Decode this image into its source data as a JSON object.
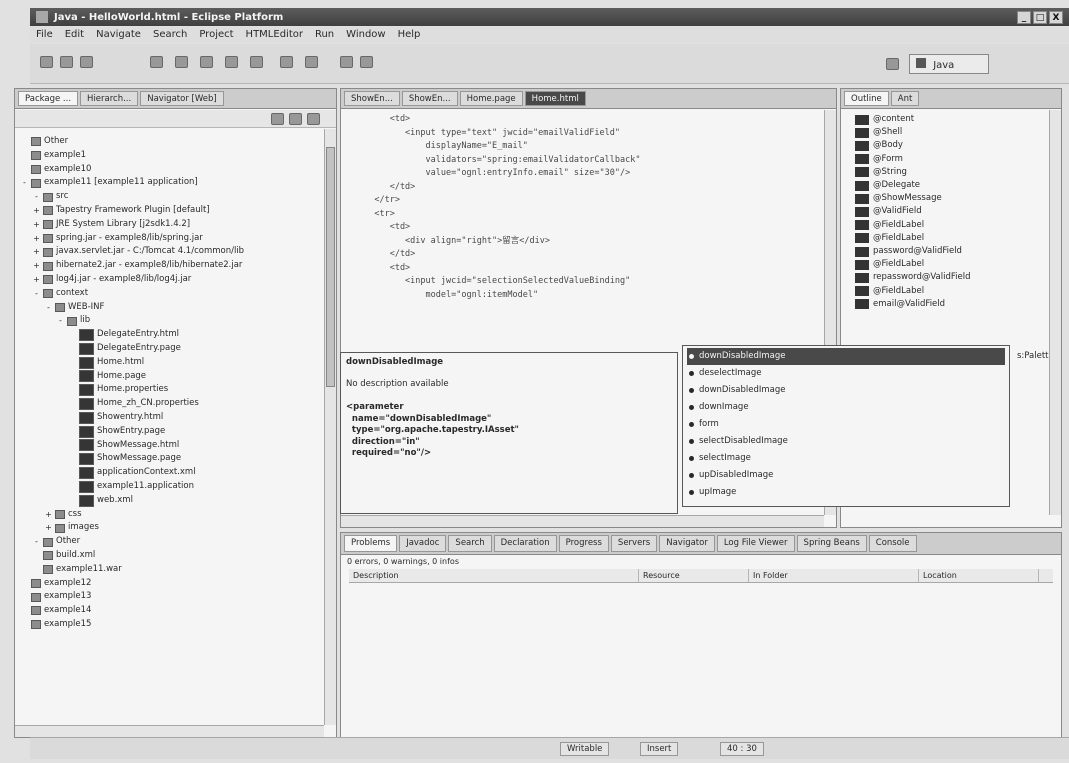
{
  "window": {
    "title": "Java - HelloWorld.html - Eclipse Platform",
    "controls": [
      "_",
      "□",
      "X"
    ]
  },
  "menu": [
    "File",
    "Edit",
    "Navigate",
    "Search",
    "Project",
    "HTMLEditor",
    "Run",
    "Window",
    "Help"
  ],
  "perspective": "Java",
  "left_panel": {
    "tabs": [
      "Package ...",
      "Hierarch...",
      "Navigator [Web]"
    ],
    "tree": [
      {
        "indent": 0,
        "exp": "",
        "label": "Other"
      },
      {
        "indent": 0,
        "exp": "",
        "label": "example1"
      },
      {
        "indent": 0,
        "exp": "",
        "label": "example10"
      },
      {
        "indent": 0,
        "exp": "-",
        "label": "example11 [example11 application]"
      },
      {
        "indent": 1,
        "exp": "-",
        "label": "src"
      },
      {
        "indent": 1,
        "exp": "+",
        "label": "Tapestry Framework Plugin [default]"
      },
      {
        "indent": 1,
        "exp": "+",
        "label": "JRE System Library [j2sdk1.4.2]"
      },
      {
        "indent": 1,
        "exp": "+",
        "label": "spring.jar - example8/lib/spring.jar"
      },
      {
        "indent": 1,
        "exp": "+",
        "label": "javax.servlet.jar - C:/Tomcat 4.1/common/lib"
      },
      {
        "indent": 1,
        "exp": "+",
        "label": "hibernate2.jar - example8/lib/hibernate2.jar"
      },
      {
        "indent": 1,
        "exp": "+",
        "label": "log4j.jar - example8/lib/log4j.jar"
      },
      {
        "indent": 1,
        "exp": "-",
        "label": "context"
      },
      {
        "indent": 2,
        "exp": "-",
        "label": "WEB-INF"
      },
      {
        "indent": 3,
        "exp": "-",
        "label": "lib"
      },
      {
        "indent": 4,
        "exp": "",
        "label": "DelegateEntry.html",
        "dark": true
      },
      {
        "indent": 4,
        "exp": "",
        "label": "DelegateEntry.page",
        "dark": true
      },
      {
        "indent": 4,
        "exp": "",
        "label": "Home.html",
        "dark": true
      },
      {
        "indent": 4,
        "exp": "",
        "label": "Home.page",
        "dark": true
      },
      {
        "indent": 4,
        "exp": "",
        "label": "Home.properties",
        "dark": true
      },
      {
        "indent": 4,
        "exp": "",
        "label": "Home_zh_CN.properties",
        "dark": true
      },
      {
        "indent": 4,
        "exp": "",
        "label": "Showentry.html",
        "dark": true
      },
      {
        "indent": 4,
        "exp": "",
        "label": "ShowEntry.page",
        "dark": true
      },
      {
        "indent": 4,
        "exp": "",
        "label": "ShowMessage.html",
        "dark": true
      },
      {
        "indent": 4,
        "exp": "",
        "label": "ShowMessage.page",
        "dark": true
      },
      {
        "indent": 4,
        "exp": "",
        "label": "applicationContext.xml",
        "dark": true
      },
      {
        "indent": 4,
        "exp": "",
        "label": "example11.application",
        "dark": true
      },
      {
        "indent": 4,
        "exp": "",
        "label": "web.xml",
        "dark": true
      },
      {
        "indent": 2,
        "exp": "+",
        "label": "css"
      },
      {
        "indent": 2,
        "exp": "+",
        "label": "images"
      },
      {
        "indent": 1,
        "exp": "-",
        "label": "Other"
      },
      {
        "indent": 1,
        "exp": "",
        "label": "build.xml"
      },
      {
        "indent": 1,
        "exp": "",
        "label": "example11.war"
      },
      {
        "indent": 0,
        "exp": "",
        "label": "example12"
      },
      {
        "indent": 0,
        "exp": "",
        "label": "example13"
      },
      {
        "indent": 0,
        "exp": "",
        "label": "example14"
      },
      {
        "indent": 0,
        "exp": "",
        "label": "example15"
      }
    ]
  },
  "editor": {
    "tabs": [
      "ShowEn...",
      "ShowEn...",
      "Home.page",
      "Home.html"
    ],
    "code": [
      "      <td>",
      "         <input type=\"text\" jwcid=\"emailValidField\"",
      "             displayName=\"E_mail\"",
      "             validators=\"spring:emailValidatorCallback\"",
      "             value=\"ognl:entryInfo.email\" size=\"30\"/>",
      "      </td>",
      "   </tr>",
      "   <tr>",
      "      <td>",
      "         <div align=\"right\">留言</div>",
      "      </td>",
      "      <td>",
      "         <input jwcid=\"selectionSelectedValueBinding\"",
      "             model=\"ognl:itemModel\""
    ]
  },
  "outline": {
    "tabs": [
      "Outline",
      "Ant"
    ],
    "items": [
      "@content",
      "@Shell",
      "@Body",
      "@Form",
      "@String",
      "@Delegate",
      "@ShowMessage",
      "@ValidField",
      "@FieldLabel",
      "@FieldLabel",
      "password@ValidField",
      "@FieldLabel",
      "repassword@ValidField",
      "@FieldLabel",
      "email@ValidField"
    ],
    "overflow_text": "s:Palette"
  },
  "assist_doc": {
    "heading": "downDisabledImage",
    "description": "No description available",
    "lines": [
      "<parameter",
      "  name=\"downDisabledImage\"",
      "  type=\"org.apache.tapestry.IAsset\"",
      "  direction=\"in\"",
      "  required=\"no\"/>"
    ]
  },
  "assist_list": {
    "selected_index": 0,
    "items": [
      "downDisabledImage",
      "deselectImage",
      "downDisabledImage",
      "downImage",
      "form",
      "selectDisabledImage",
      "selectImage",
      "upDisabledImage",
      "upImage"
    ]
  },
  "problems": {
    "tabs": [
      "Problems",
      "Javadoc",
      "Search",
      "Declaration",
      "Progress",
      "Servers",
      "Navigator",
      "Log File Viewer",
      "Spring Beans",
      "Console"
    ],
    "summary": "0 errors, 0 warnings, 0 infos",
    "columns": [
      "Description",
      "Resource",
      "In Folder",
      "Location"
    ]
  },
  "status": [
    "Writable",
    "Insert",
    "40 : 30"
  ]
}
